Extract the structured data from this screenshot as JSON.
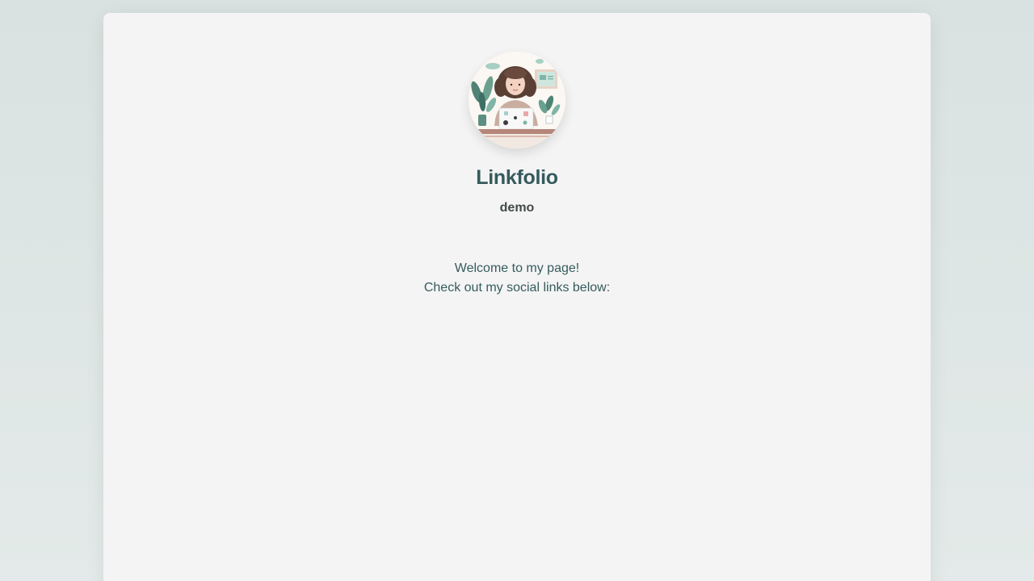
{
  "profile": {
    "avatar_icon": "profile-illustration-woman-at-laptop",
    "title": "Linkfolio",
    "username": "demo",
    "bio_lines": [
      "Welcome to my page!",
      "Check out my social links below:"
    ]
  },
  "colors": {
    "background": "#dde5e4",
    "card": "#f4f4f4",
    "title": "#355b5e",
    "username": "#444a4a",
    "bio": "#355b5e"
  }
}
